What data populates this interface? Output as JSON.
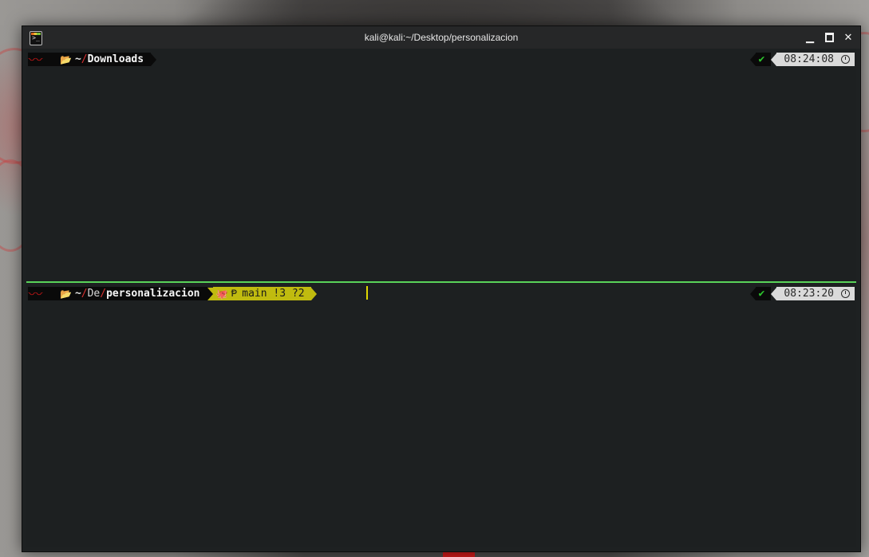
{
  "window": {
    "title": "kali@kali:~/Desktop/personalizacion",
    "app_icon": "terminal-icon",
    "controls": {
      "minimize": "minimize-icon",
      "maximize": "maximize-icon",
      "close": "close-icon",
      "minimize_glyph": "▁",
      "close_glyph": "✕"
    }
  },
  "colors": {
    "divider": "#5cdb5c",
    "git_segment": "#c7c20f",
    "folder_accent": "#e02424",
    "status_ok": "#2ecc2e"
  },
  "panes": [
    {
      "id": "top",
      "prompt": {
        "os_icon": "kali-dragon-icon",
        "os_glyph": "〰",
        "folder_icon": "folder-open-icon",
        "folder_glyph": "📂",
        "tilde": "~",
        "slash": "/",
        "path_dim": "",
        "path_bold": "Downloads"
      },
      "right": {
        "status_glyph": "✔",
        "time": "08:24:08",
        "clock_icon": "clock-icon"
      }
    },
    {
      "id": "bottom",
      "prompt": {
        "os_icon": "kali-dragon-icon",
        "os_glyph": "〰",
        "folder_icon": "folder-open-icon",
        "folder_glyph": "📂",
        "tilde": "~",
        "slash1": "/",
        "path_dim": "De",
        "slash2": "/",
        "path_bold": "personalizacion"
      },
      "git": {
        "github_glyph": "🐙",
        "branch_glyph": "Ᵽ",
        "text": "main !3 ?2"
      },
      "right": {
        "status_glyph": "✔",
        "time": "08:23:20",
        "clock_icon": "clock-icon"
      }
    }
  ]
}
